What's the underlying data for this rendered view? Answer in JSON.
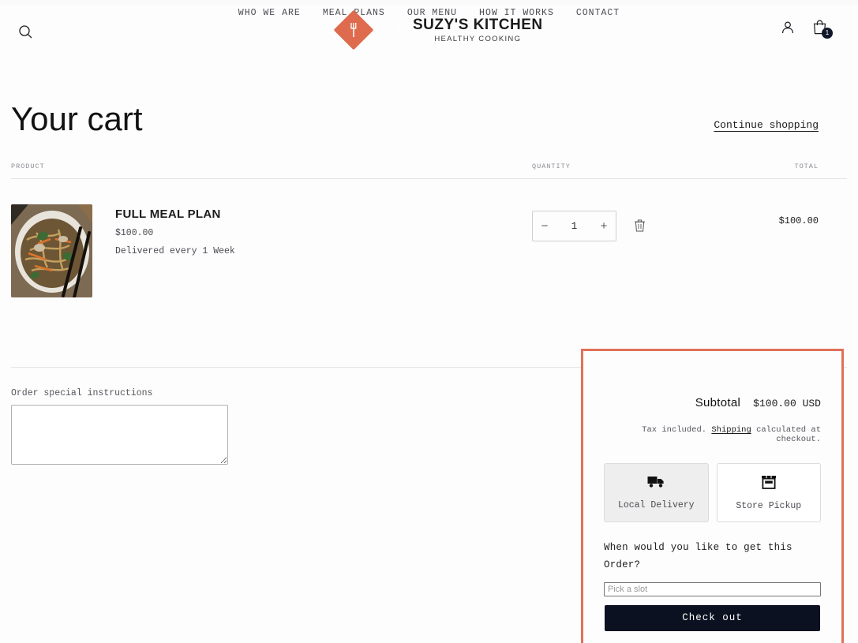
{
  "header": {
    "search_icon": "search-icon",
    "logo": {
      "title": "SUZY'S KITCHEN",
      "subtitle": "HEALTHY COOKING",
      "diamond_colors": [
        "#df6b4f",
        "#63ab7e",
        "#ebcc48"
      ],
      "diamond_icons": [
        "fork-icon",
        "spoon-icon",
        "knife-icon"
      ]
    },
    "account_icon": "account-icon",
    "cart_icon": "shopping-bag-icon",
    "cart_count": "1",
    "nav": [
      {
        "label": "WHO WE ARE"
      },
      {
        "label": "MEAL PLANS"
      },
      {
        "label": "OUR MENU"
      },
      {
        "label": "HOW IT WORKS"
      },
      {
        "label": "CONTACT"
      }
    ]
  },
  "cart": {
    "title": "Your cart",
    "continue_shopping": "Continue shopping",
    "columns": {
      "product": "PRODUCT",
      "quantity": "QUANTITY",
      "total": "TOTAL"
    },
    "items": [
      {
        "name": "FULL MEAL PLAN",
        "price": "$100.00",
        "subscription": "Delivered every 1 Week",
        "quantity": "1",
        "decrease_label": "−",
        "increase_label": "+",
        "remove_icon": "trash-icon",
        "line_total": "$100.00",
        "image_alt": "noodle-stir-fry-bowl"
      }
    ],
    "instructions_label": "Order special instructions",
    "instructions_value": "",
    "instructions_placeholder": ""
  },
  "summary": {
    "subtotal_label": "Subtotal",
    "subtotal_value": "$100.00 USD",
    "tax_note_before": "Tax included. ",
    "tax_note_link": "Shipping",
    "tax_note_after": " calculated at checkout.",
    "methods": [
      {
        "label": "Local Delivery",
        "icon": "delivery-truck-icon",
        "selected": true
      },
      {
        "label": "Store Pickup",
        "icon": "store-icon",
        "selected": false
      }
    ],
    "slot_question": "When would you like to get this Order?",
    "slot_placeholder": "Pick a slot",
    "slot_value": "",
    "checkout_label": "Check out",
    "highlight_color": "#e0705a",
    "checkout_bg": "#0b1120"
  }
}
